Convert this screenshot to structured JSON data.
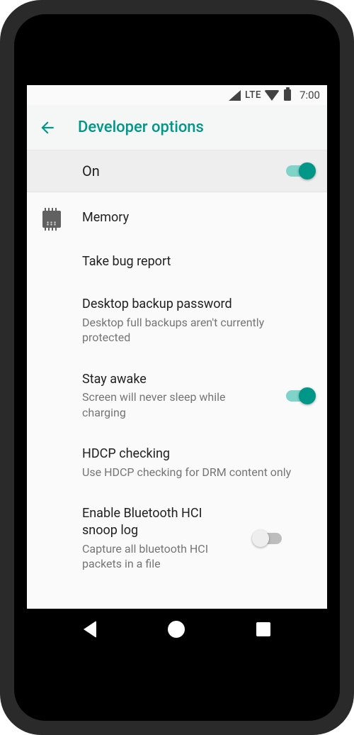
{
  "status": {
    "network": "LTE",
    "time": "7:00"
  },
  "appbar": {
    "title": "Developer options"
  },
  "master": {
    "label": "On",
    "enabled": true
  },
  "items": [
    {
      "title": "Memory",
      "icon": "chip-icon"
    },
    {
      "title": "Take bug report"
    },
    {
      "title": "Desktop backup password",
      "sub": "Desktop full backups aren't currently protected"
    },
    {
      "title": "Stay awake",
      "sub": "Screen will never sleep while charging",
      "toggle": true,
      "enabled": true
    },
    {
      "title": "HDCP checking",
      "sub": "Use HDCP checking for DRM content only"
    },
    {
      "title": "Enable Bluetooth HCI snoop log",
      "sub": "Capture all bluetooth HCI packets in a file",
      "toggle": true,
      "enabled": false
    }
  ],
  "colors": {
    "accent": "#009688",
    "accent_track": "#7fd3c9",
    "text_primary": "#212121",
    "text_secondary": "#757575"
  }
}
